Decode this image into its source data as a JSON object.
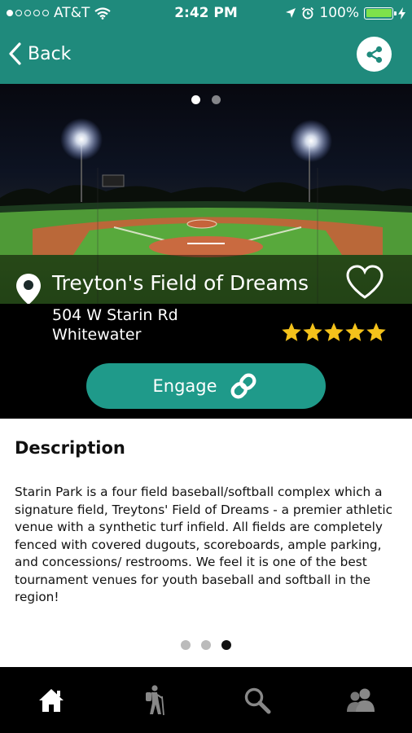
{
  "status_bar": {
    "carrier": "AT&T",
    "time": "2:42 PM",
    "battery": "100%",
    "battery_level": 1.0,
    "signal_dots_filled": 1,
    "signal_dots_total": 5
  },
  "nav": {
    "back_label": "Back",
    "share_icon": "share-icon"
  },
  "venue": {
    "name": "Treyton's Field of Dreams",
    "address_line1": "504 W Starin Rd",
    "address_line2": "Whitewater",
    "rating": 5,
    "rating_max": 5,
    "favorited": false
  },
  "image_pager": {
    "count": 2,
    "active_index": 0
  },
  "engage_label": "Engage",
  "description": {
    "heading": "Description",
    "text": "Starin Park is a four field baseball/softball complex which a signature field, Treytons' Field of Dreams - a premier athletic venue with a synthetic turf infield.  All fields are completely fenced with covered dugouts, scoreboards, ample parking, and concessions/ restrooms.  We feel it is one of the best tournament venues for youth baseball and softball in the region!"
  },
  "content_pager": {
    "count": 3,
    "active_index": 2
  },
  "tabs": [
    {
      "icon": "home-icon"
    },
    {
      "icon": "hiker-icon"
    },
    {
      "icon": "search-icon"
    },
    {
      "icon": "users-icon"
    }
  ],
  "colors": {
    "brand_teal": "#1f8a7c",
    "engage_teal": "#1f9a8a",
    "star_gold": "#f4c21b"
  }
}
